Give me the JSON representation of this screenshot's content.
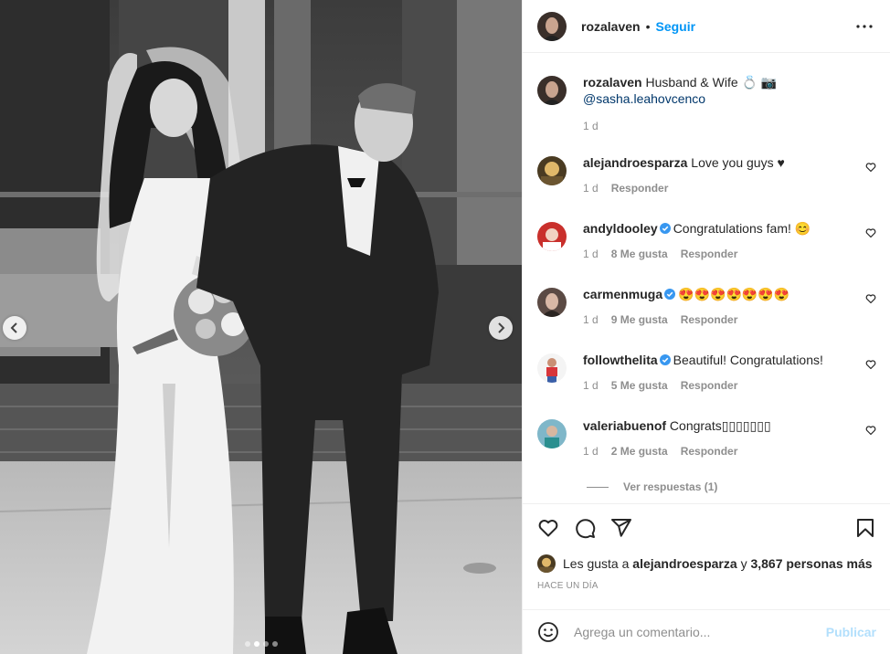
{
  "post": {
    "username": "rozalaven",
    "follow_label": "Seguir",
    "header_separator": "•",
    "caption_user": "rozalaven",
    "caption_text": "Husband & Wife 💍 📷",
    "caption_mention": "@sasha.leahovcenco",
    "caption_time": "1 d"
  },
  "comments": [
    {
      "user": "alejandroesparza",
      "verified": false,
      "text": "Love you guys ♥",
      "time": "1 d",
      "likes": "",
      "reply_label": "Responder"
    },
    {
      "user": "andyldooley",
      "verified": true,
      "text": "Congratulations fam! 😊",
      "time": "1 d",
      "likes": "8 Me gusta",
      "reply_label": "Responder"
    },
    {
      "user": "carmenmuga",
      "verified": true,
      "text": "😍😍😍😍😍😍😍",
      "time": "1 d",
      "likes": "9 Me gusta",
      "reply_label": "Responder"
    },
    {
      "user": "followthelita",
      "verified": true,
      "text": "Beautiful! Congratulations!",
      "time": "1 d",
      "likes": "5 Me gusta",
      "reply_label": "Responder"
    },
    {
      "user": "valeriabuenof",
      "verified": false,
      "text": "Congrats▯▯▯▯▯▯▯",
      "time": "1 d",
      "likes": "2 Me gusta",
      "reply_label": "Responder"
    }
  ],
  "view_replies_label": "Ver respuestas (1)",
  "likes": {
    "prefix": "Les gusta a",
    "user": "alejandroesparza",
    "middle": "y",
    "count": "3,867 personas más"
  },
  "time_ago": "HACE UN DÍA",
  "comment_box": {
    "placeholder": "Agrega un comentario...",
    "publish_label": "Publicar"
  },
  "carousel": {
    "total": 4,
    "active_index": 1
  },
  "icons": [
    "more-icon",
    "heart-icon",
    "comment-icon",
    "share-icon",
    "bookmark-icon",
    "emoji-icon",
    "verified-icon",
    "chevron-left-icon",
    "chevron-right-icon"
  ],
  "colors": {
    "accent": "#0095f6",
    "verified": "#3897f0",
    "muted": "#8e8e8e",
    "publish_disabled": "#b2dffc"
  }
}
